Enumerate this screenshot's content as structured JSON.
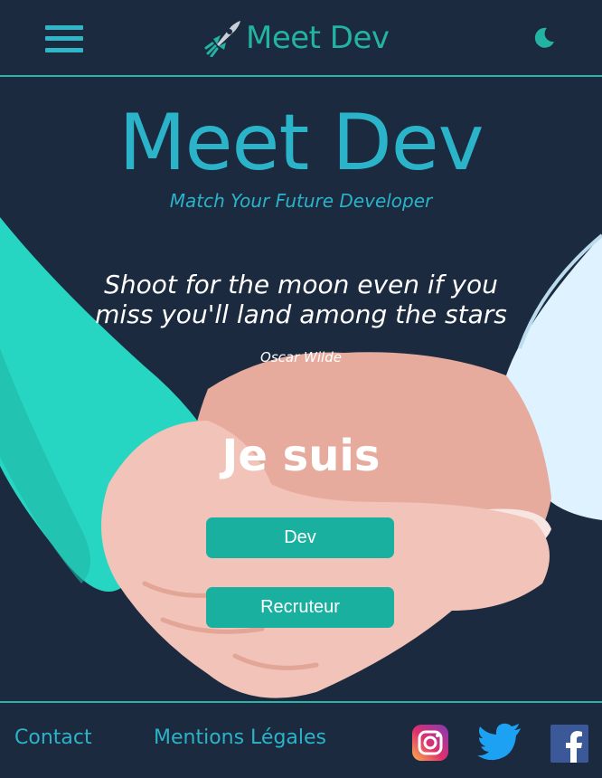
{
  "header": {
    "brand": "Meet Dev",
    "icons": {
      "menu": "hamburger-menu-icon",
      "logo": "rocket-icon",
      "theme": "moon-icon"
    }
  },
  "hero": {
    "title": "Meet Dev",
    "subtitle": "Match Your Future Developer",
    "quote_line1": "Shoot for the moon even if you",
    "quote_line2": "miss you'll land among the stars",
    "author": "Oscar Wilde",
    "prompt": "Je suis",
    "buttons": {
      "dev": "Dev",
      "recruiter": "Recruteur"
    }
  },
  "footer": {
    "contact": "Contact",
    "legal": "Mentions Légales",
    "social": [
      "instagram-icon",
      "twitter-icon",
      "facebook-icon"
    ]
  },
  "colors": {
    "background": "#1b2a3e",
    "accent": "#2bb3c9",
    "teal": "#22b3a2",
    "button": "#1ab09f"
  }
}
